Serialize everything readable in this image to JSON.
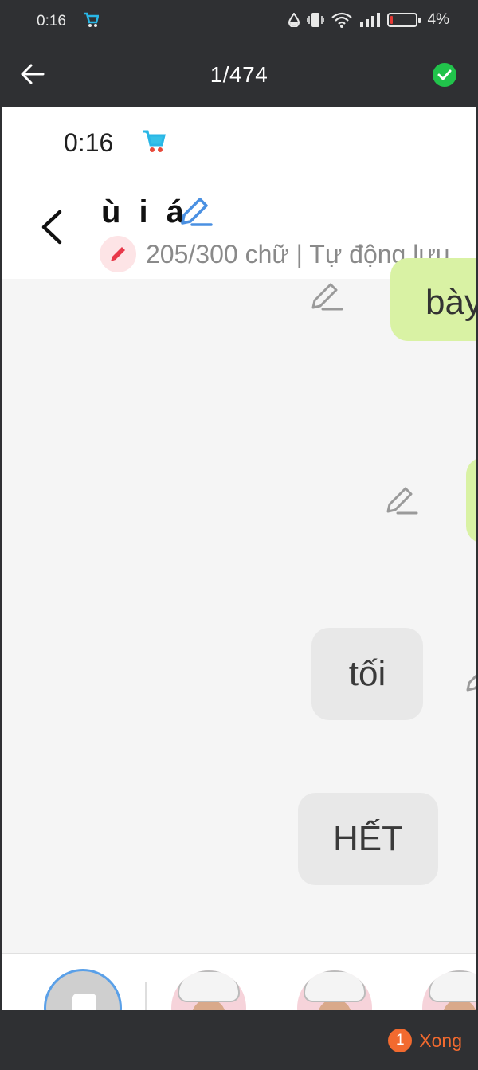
{
  "status_bar": {
    "time": "0:16",
    "battery_pct": "4%",
    "battery_level": 0.04
  },
  "viewer": {
    "counter": "1/474"
  },
  "screenshot": {
    "time": "0:16",
    "chat_title": "ù i á",
    "subtitle": "205/300 chữ | Tự động lưu",
    "messages": [
      {
        "text": "bày",
        "style": "green"
      },
      {
        "text": "",
        "style": "green"
      },
      {
        "text": "tối",
        "style": "grey"
      },
      {
        "text": "HẾT",
        "style": "grey"
      }
    ]
  },
  "footer": {
    "badge_count": "1",
    "done_label": "Xong"
  },
  "colors": {
    "accent": "#f26a2f",
    "check_green": "#21c34b",
    "bubble_green": "#d9f2a4",
    "bubble_grey": "#e8e8e8"
  }
}
